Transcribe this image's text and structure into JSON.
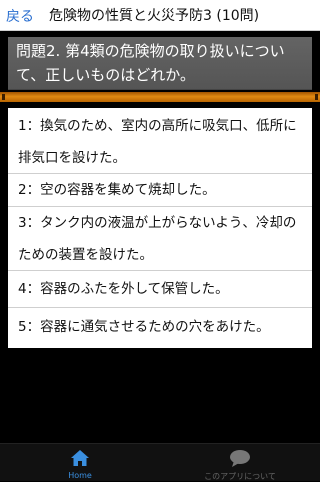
{
  "header": {
    "back_label": "戻る",
    "title": "危険物の性質と火災予防3 (10問)"
  },
  "question": {
    "text": "問題2. 第4類の危険物の取り扱いについて、正しいものはどれか。"
  },
  "answers": [
    {
      "label": "1：換気のため、室内の高所に吸気口、低所に排気口を設けた。"
    },
    {
      "label": "2：空の容器を集めて焼却した。"
    },
    {
      "label": "3：タンク内の液温が上がらないよう、冷却のための装置を設けた。"
    },
    {
      "label": "4：容器のふたを外して保管した。"
    },
    {
      "label": "5：容器に通気させるための穴をあけた。"
    }
  ],
  "tabs": [
    {
      "label": "Home",
      "icon": "home-icon",
      "active": true
    },
    {
      "label": "このアプリについて",
      "icon": "speech-bubble-icon",
      "active": false
    }
  ],
  "colors": {
    "accent": "#3a8fe0",
    "divider": "#e08a12",
    "question_bg": "#5c5c5c"
  }
}
